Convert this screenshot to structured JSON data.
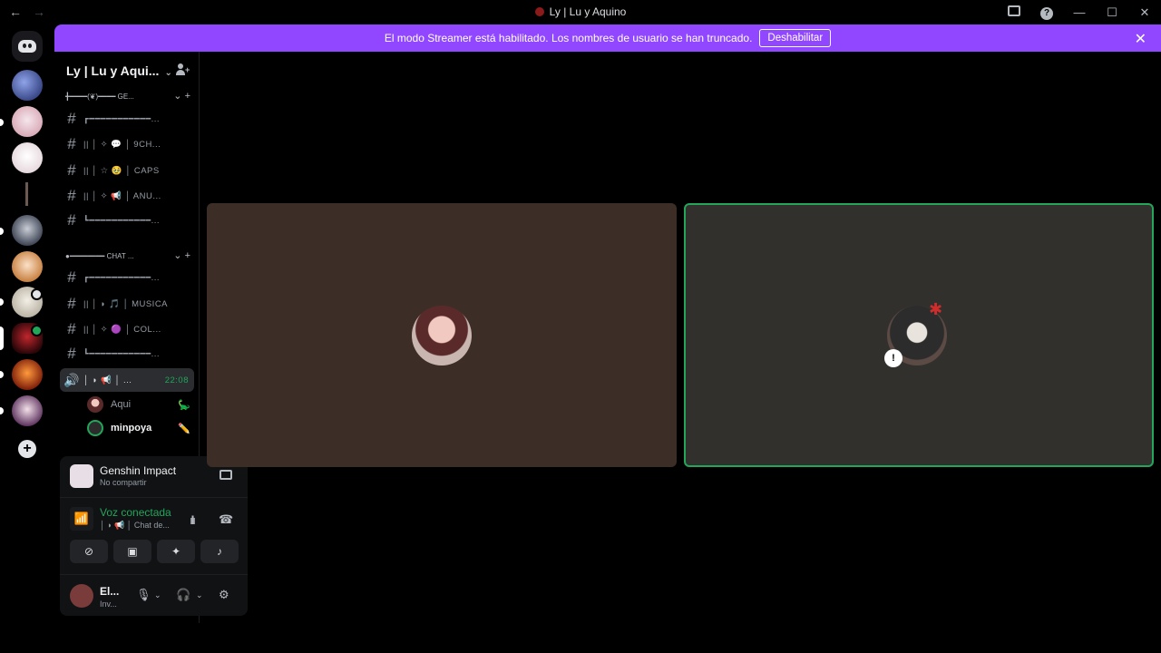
{
  "window": {
    "title": "Ly | Lu y Aquino"
  },
  "banner": {
    "text": "El modo Streamer está habilitado. Los nombres de usuario se han truncado.",
    "button": "Deshabilitar"
  },
  "server": {
    "name": "Ly | Lu y Aqui...",
    "categories": [
      {
        "label": "╋━━━━(❦)━━━━ GE..."
      },
      {
        "label": "●━━━━━━━━ CHAT ..."
      }
    ],
    "channels_group1": [
      {
        "name": "┏━━━━━━━━━━━..."
      },
      {
        "name": "|| │ ✧ 💬 │ 9CH..."
      },
      {
        "name": "|| │ ☆ 🥹 │ CAPS"
      },
      {
        "name": "|| │ ✧ 📢 │ ANU..."
      },
      {
        "name": "┗━━━━━━━━━━━..."
      }
    ],
    "channels_group2": [
      {
        "name": "┏━━━━━━━━━━━..."
      },
      {
        "name": "|| │ ◗ 🎵 │ MUSICA"
      },
      {
        "name": "|| │ ✧ 🟣 │ COL..."
      },
      {
        "name": "┗━━━━━━━━━━━..."
      }
    ],
    "voice_channel": {
      "name": "│ ◗ 📢 │ ...",
      "time": "22:08",
      "users": [
        {
          "name": "Aqui",
          "icon": "🦕"
        },
        {
          "name": "minpoya",
          "icon": "✏️"
        }
      ]
    }
  },
  "activity": {
    "game": "Genshin Impact",
    "status": "No compartir"
  },
  "voice": {
    "status": "Voz conectada",
    "channel": "│ ◗ 📢 │ Chat de..."
  },
  "user": {
    "name": "El...",
    "status": "Inv..."
  },
  "icons": {
    "back": "←",
    "forward": "→",
    "minimize": "—",
    "maximize": "☐",
    "close": "✕"
  }
}
